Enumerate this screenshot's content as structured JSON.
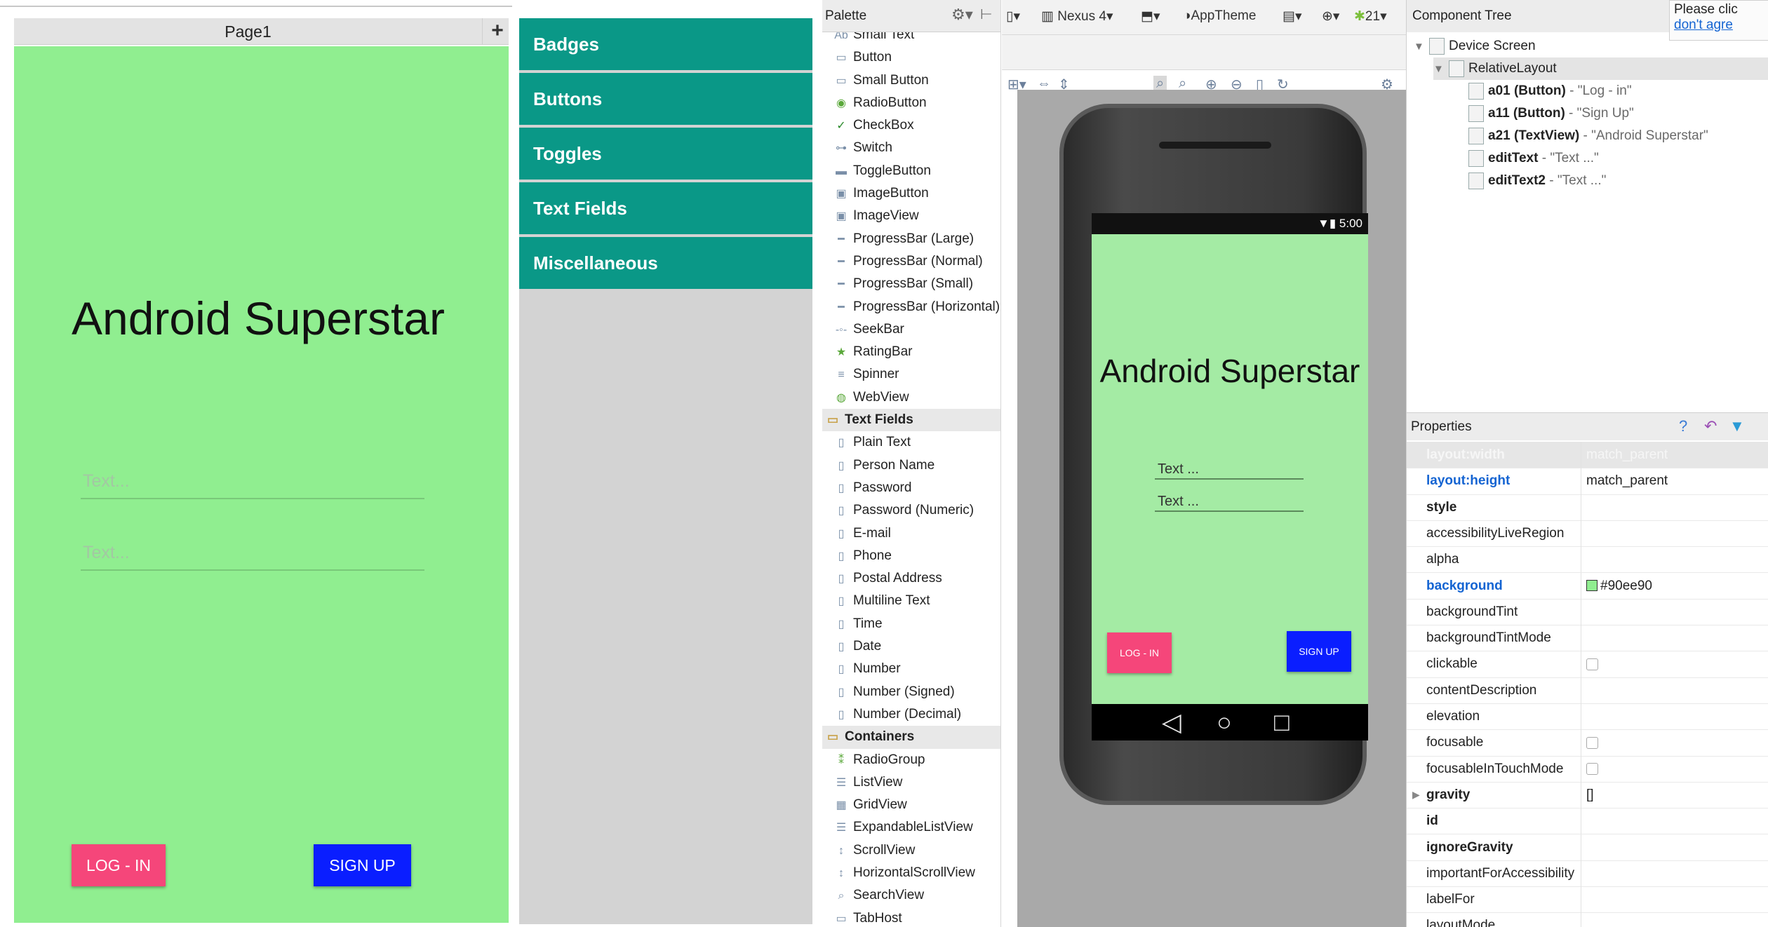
{
  "page_mock": {
    "tab_label": "Page1",
    "add_tab": "+",
    "title": "Android Superstar",
    "field1_placeholder": "Text...",
    "field2_placeholder": "Text...",
    "login_label": "LOG - IN",
    "signup_label": "SIGN UP",
    "background_color": "#90ee90"
  },
  "categories": [
    "Badges",
    "Buttons",
    "Toggles",
    "Text Fields",
    "Miscellaneous"
  ],
  "palette": {
    "title": "Palette",
    "items": [
      {
        "type": "item",
        "label": "Small Text",
        "icon": "text-icon"
      },
      {
        "type": "item",
        "label": "Button",
        "icon": "button-icon"
      },
      {
        "type": "item",
        "label": "Small Button",
        "icon": "button-icon"
      },
      {
        "type": "item",
        "label": "RadioButton",
        "icon": "radio-icon"
      },
      {
        "type": "item",
        "label": "CheckBox",
        "icon": "checkbox-icon"
      },
      {
        "type": "item",
        "label": "Switch",
        "icon": "switch-icon"
      },
      {
        "type": "item",
        "label": "ToggleButton",
        "icon": "toggle-icon"
      },
      {
        "type": "item",
        "label": "ImageButton",
        "icon": "image-icon"
      },
      {
        "type": "item",
        "label": "ImageView",
        "icon": "image-icon"
      },
      {
        "type": "item",
        "label": "ProgressBar (Large)",
        "icon": "progress-icon"
      },
      {
        "type": "item",
        "label": "ProgressBar (Normal)",
        "icon": "progress-icon"
      },
      {
        "type": "item",
        "label": "ProgressBar (Small)",
        "icon": "progress-icon"
      },
      {
        "type": "item",
        "label": "ProgressBar (Horizontal)",
        "icon": "progress-icon"
      },
      {
        "type": "item",
        "label": "SeekBar",
        "icon": "seekbar-icon"
      },
      {
        "type": "item",
        "label": "RatingBar",
        "icon": "star-icon"
      },
      {
        "type": "item",
        "label": "Spinner",
        "icon": "spinner-icon"
      },
      {
        "type": "item",
        "label": "WebView",
        "icon": "globe-icon"
      },
      {
        "type": "section",
        "label": "Text Fields",
        "icon": "folder-icon"
      },
      {
        "type": "item",
        "label": "Plain Text",
        "icon": "textfield-icon"
      },
      {
        "type": "item",
        "label": "Person Name",
        "icon": "textfield-icon"
      },
      {
        "type": "item",
        "label": "Password",
        "icon": "textfield-icon"
      },
      {
        "type": "item",
        "label": "Password (Numeric)",
        "icon": "textfield-icon"
      },
      {
        "type": "item",
        "label": "E-mail",
        "icon": "textfield-icon"
      },
      {
        "type": "item",
        "label": "Phone",
        "icon": "textfield-icon"
      },
      {
        "type": "item",
        "label": "Postal Address",
        "icon": "textfield-icon"
      },
      {
        "type": "item",
        "label": "Multiline Text",
        "icon": "textfield-icon"
      },
      {
        "type": "item",
        "label": "Time",
        "icon": "textfield-icon"
      },
      {
        "type": "item",
        "label": "Date",
        "icon": "textfield-icon"
      },
      {
        "type": "item",
        "label": "Number",
        "icon": "textfield-icon"
      },
      {
        "type": "item",
        "label": "Number (Signed)",
        "icon": "textfield-icon"
      },
      {
        "type": "item",
        "label": "Number (Decimal)",
        "icon": "textfield-icon"
      },
      {
        "type": "section",
        "label": "Containers",
        "icon": "folder-icon"
      },
      {
        "type": "item",
        "label": "RadioGroup",
        "icon": "radiogroup-icon"
      },
      {
        "type": "item",
        "label": "ListView",
        "icon": "list-icon"
      },
      {
        "type": "item",
        "label": "GridView",
        "icon": "grid-icon"
      },
      {
        "type": "item",
        "label": "ExpandableListView",
        "icon": "list-icon"
      },
      {
        "type": "item",
        "label": "ScrollView",
        "icon": "scroll-icon"
      },
      {
        "type": "item",
        "label": "HorizontalScrollView",
        "icon": "scroll-icon"
      },
      {
        "type": "item",
        "label": "SearchView",
        "icon": "search-icon"
      },
      {
        "type": "item",
        "label": "TabHost",
        "icon": "tab-icon"
      }
    ]
  },
  "design_toolbar": {
    "device": "Nexus 4",
    "theme": "AppTheme",
    "api": "21"
  },
  "device_preview": {
    "status_time": "5:00",
    "title": "Android Superstar",
    "field1": "Text ...",
    "field2": "Text ...",
    "login": "LOG - IN",
    "signup": "SIGN UP"
  },
  "component_tree": {
    "title": "Component Tree",
    "tooltip_line1": "Please clic",
    "tooltip_line2": "don't agre",
    "rows": [
      {
        "name": "Device Screen",
        "detail": "",
        "level": 0,
        "expand": "▼"
      },
      {
        "name": "RelativeLayout",
        "detail": "",
        "level": 1,
        "expand": "▼"
      },
      {
        "name": "a01 (Button)",
        "detail": " - \"Log - in\"",
        "level": 2,
        "expand": ""
      },
      {
        "name": "a11 (Button)",
        "detail": " - \"Sign Up\"",
        "level": 2,
        "expand": ""
      },
      {
        "name": "a21 (TextView)",
        "detail": " - \"Android Superstar\"",
        "level": 2,
        "expand": ""
      },
      {
        "name": "editText",
        "detail": " - \"Text ...\"",
        "level": 2,
        "expand": ""
      },
      {
        "name": "editText2",
        "detail": " - \"Text ...\"",
        "level": 2,
        "expand": ""
      }
    ]
  },
  "properties": {
    "title": "Properties",
    "rows": [
      {
        "name": "layout:width",
        "value": "match_parent",
        "style": "faded"
      },
      {
        "name": "layout:height",
        "value": "match_parent",
        "style": "link"
      },
      {
        "name": "style",
        "value": "",
        "style": "bold"
      },
      {
        "name": "accessibilityLiveRegion",
        "value": "",
        "style": "normal"
      },
      {
        "name": "alpha",
        "value": "",
        "style": "normal"
      },
      {
        "name": "background",
        "value": "#90ee90",
        "style": "link",
        "swatch": "#90ee90"
      },
      {
        "name": "backgroundTint",
        "value": "",
        "style": "normal"
      },
      {
        "name": "backgroundTintMode",
        "value": "",
        "style": "normal"
      },
      {
        "name": "clickable",
        "value": "",
        "style": "normal",
        "checkbox": true
      },
      {
        "name": "contentDescription",
        "value": "",
        "style": "normal"
      },
      {
        "name": "elevation",
        "value": "",
        "style": "normal"
      },
      {
        "name": "focusable",
        "value": "",
        "style": "normal",
        "checkbox": true
      },
      {
        "name": "focusableInTouchMode",
        "value": "",
        "style": "normal",
        "checkbox": true
      },
      {
        "name": "gravity",
        "value": "[]",
        "style": "bold",
        "expand": true
      },
      {
        "name": "id",
        "value": "",
        "style": "bold"
      },
      {
        "name": "ignoreGravity",
        "value": "",
        "style": "bold"
      },
      {
        "name": "importantForAccessibility",
        "value": "",
        "style": "normal"
      },
      {
        "name": "labelFor",
        "value": "",
        "style": "normal"
      },
      {
        "name": "layoutMode",
        "value": "",
        "style": "normal"
      }
    ]
  },
  "colors": {
    "category_teal": "#0a9887",
    "login_pink": "#f5467a",
    "signup_blue": "#0a1eff",
    "link_blue": "#1464d2"
  }
}
